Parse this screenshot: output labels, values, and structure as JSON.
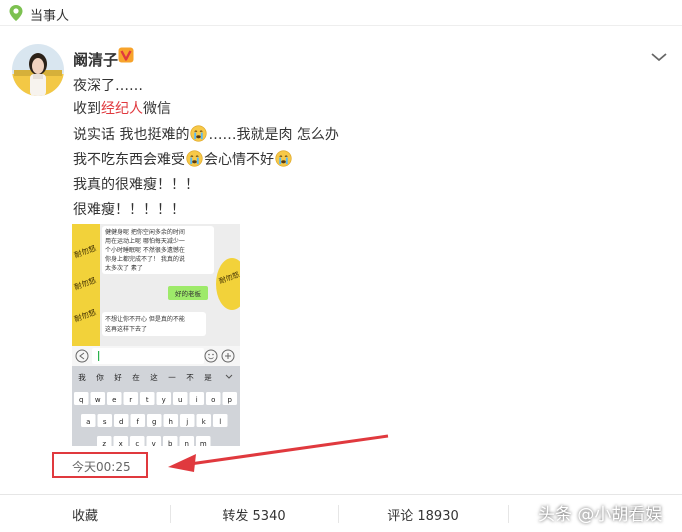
{
  "header": {
    "title": "当事人"
  },
  "post": {
    "username": "阚清子",
    "lines": {
      "l1": "夜深了……",
      "l2_pre": "收到",
      "l2_red": "经纪人",
      "l2_post": "微信",
      "l3_pre": "说实话 我也挺难的",
      "l3_post": "……我就是肉 怎么办",
      "l4_pre": "我不吃东西会难受",
      "l4_post": "会心情不好",
      "l5": "我真的很难瘦！！！",
      "l6": "很难瘦！！！！！"
    },
    "time": "今天00:25"
  },
  "screenshot": {
    "msg1": [
      "健健身呢 把你空闲多余的时间",
      "用在运动上呢 哪怕每天减少一",
      "个小时睡眠呢 不然很多遗憾在",
      "你身上都完成不了！ 我真的说",
      "太多次了 素了"
    ],
    "msg2": "好的老板",
    "msg3": [
      "不想让你不开心 但是真的不能",
      "这再这样下去了"
    ],
    "sticker_text": "耐勿怒",
    "kb_row1": [
      "我",
      "你",
      "好",
      "在",
      "这",
      "一",
      "不",
      "是"
    ],
    "kb_row2": [
      "q",
      "w",
      "e",
      "r",
      "t",
      "y",
      "u",
      "i",
      "o",
      "p"
    ],
    "kb_row3": [
      "a",
      "s",
      "d",
      "f",
      "g",
      "h",
      "j",
      "k",
      "l"
    ],
    "kb_row4": [
      "z",
      "x",
      "c",
      "v",
      "b",
      "n",
      "m"
    ]
  },
  "footer": {
    "collect": "收藏",
    "repost": "转发 5340",
    "comment": "评论 18930"
  },
  "watermark": "头条 @小胡看娱",
  "colors": {
    "accent_red": "#e0393e",
    "verified_orange": "#f7a32b",
    "chat_green": "#9eea6a"
  }
}
